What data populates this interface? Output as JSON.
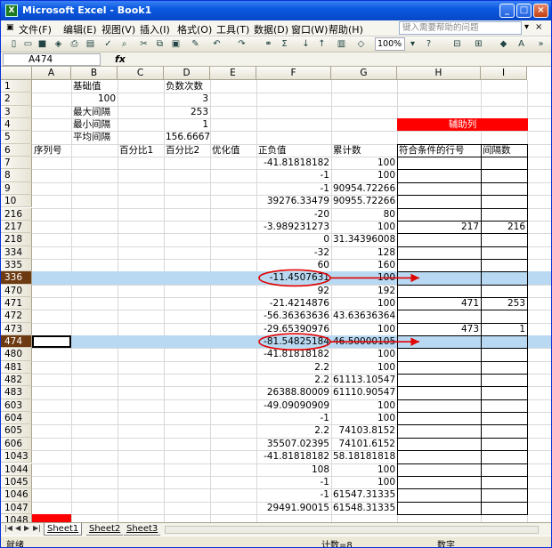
{
  "title": "Microsoft Excel - Book1",
  "menu": [
    "文件(F)",
    "编辑(E)",
    "视图(V)",
    "插入(I)",
    "格式(O)",
    "工具(T)",
    "数据(D)",
    "窗口(W)",
    "帮助(H)"
  ],
  "help_placeholder": "键入需要帮助的问题",
  "zoom": "100%",
  "namebox": "A474",
  "fx": "fx",
  "columns": [
    "A",
    "B",
    "C",
    "D",
    "E",
    "F",
    "G",
    "H",
    "I"
  ],
  "rows": [
    {
      "r": "1",
      "cells": {
        "B": "基础值",
        "D": "负数次数"
      }
    },
    {
      "r": "2",
      "cells": {
        "B": "100",
        "D": "3"
      }
    },
    {
      "r": "3",
      "cells": {
        "B": "最大间隔",
        "D": "253"
      }
    },
    {
      "r": "4",
      "cells": {
        "B": "最小间隔",
        "D": "1",
        "H": "辅助列"
      }
    },
    {
      "r": "5",
      "cells": {
        "B": "平均间隔",
        "D": "156.6667"
      }
    },
    {
      "r": "6",
      "cells": {
        "A": "序列号",
        "C": "百分比1",
        "D": "百分比2",
        "E": "优化值",
        "F": "正负值",
        "G": "累计数",
        "H": "符合条件的行号",
        "I": "间隔数"
      }
    },
    {
      "r": "7",
      "cells": {
        "F": "-41.81818182",
        "G": "100"
      }
    },
    {
      "r": "8",
      "cells": {
        "F": "-1",
        "G": "100"
      }
    },
    {
      "r": "9",
      "cells": {
        "F": "-1",
        "G": "90954.72266"
      }
    },
    {
      "r": "10",
      "cells": {
        "F": "39276.33479",
        "G": "90955.72266"
      }
    },
    {
      "r": "216",
      "cells": {
        "F": "-20",
        "G": "80"
      }
    },
    {
      "r": "217",
      "cells": {
        "F": "-3.989231273",
        "G": "100",
        "H": "217",
        "I": "216"
      }
    },
    {
      "r": "218",
      "cells": {
        "F": "0",
        "G": "31.34396008"
      }
    },
    {
      "r": "334",
      "cells": {
        "F": "-32",
        "G": "128"
      }
    },
    {
      "r": "335",
      "cells": {
        "F": "60",
        "G": "160"
      }
    },
    {
      "r": "336",
      "cells": {
        "F": "-11.4507631",
        "G": "100"
      }
    },
    {
      "r": "470",
      "cells": {
        "F": "92",
        "G": "192"
      }
    },
    {
      "r": "471",
      "cells": {
        "F": "-21.4214876",
        "G": "100",
        "H": "471",
        "I": "253"
      }
    },
    {
      "r": "472",
      "cells": {
        "F": "-56.36363636",
        "G": "43.63636364"
      }
    },
    {
      "r": "473",
      "cells": {
        "F": "-29.65390976",
        "G": "100",
        "H": "473",
        "I": "1"
      }
    },
    {
      "r": "474",
      "cells": {
        "F": "-81.54825184",
        "G": "46.50000105"
      }
    },
    {
      "r": "480",
      "cells": {
        "F": "-41.81818182",
        "G": "100"
      }
    },
    {
      "r": "481",
      "cells": {
        "F": "2.2",
        "G": "100"
      }
    },
    {
      "r": "482",
      "cells": {
        "F": "2.2",
        "G": "61113.10547"
      }
    },
    {
      "r": "483",
      "cells": {
        "F": "26388.80009",
        "G": "61110.90547"
      }
    },
    {
      "r": "603",
      "cells": {
        "F": "-49.09090909",
        "G": "100"
      }
    },
    {
      "r": "604",
      "cells": {
        "F": "-1",
        "G": "100"
      }
    },
    {
      "r": "605",
      "cells": {
        "F": "2.2",
        "G": "74103.8152"
      }
    },
    {
      "r": "606",
      "cells": {
        "F": "35507.02395",
        "G": "74101.6152"
      }
    },
    {
      "r": "1043",
      "cells": {
        "F": "-41.81818182",
        "G": "58.18181818"
      }
    },
    {
      "r": "1044",
      "cells": {
        "F": "108",
        "G": "100"
      }
    },
    {
      "r": "1045",
      "cells": {
        "F": "-1",
        "G": "100"
      }
    },
    {
      "r": "1046",
      "cells": {
        "F": "-1",
        "G": "61547.31335"
      }
    },
    {
      "r": "1047",
      "cells": {
        "F": "29491.90015",
        "G": "61548.31335"
      }
    },
    {
      "r": "1048",
      "cells": {}
    },
    {
      "r": "1049",
      "cells": {}
    }
  ],
  "sheets": [
    "Sheet1",
    "Sheet2",
    "Sheet3"
  ],
  "status": {
    "ready": "就绪",
    "count": "计数=8",
    "mode": "数字"
  },
  "colors": {
    "helper_fill": "#ff0000",
    "highlight_row": "#b9d9f2",
    "annotation": "#e00000"
  }
}
